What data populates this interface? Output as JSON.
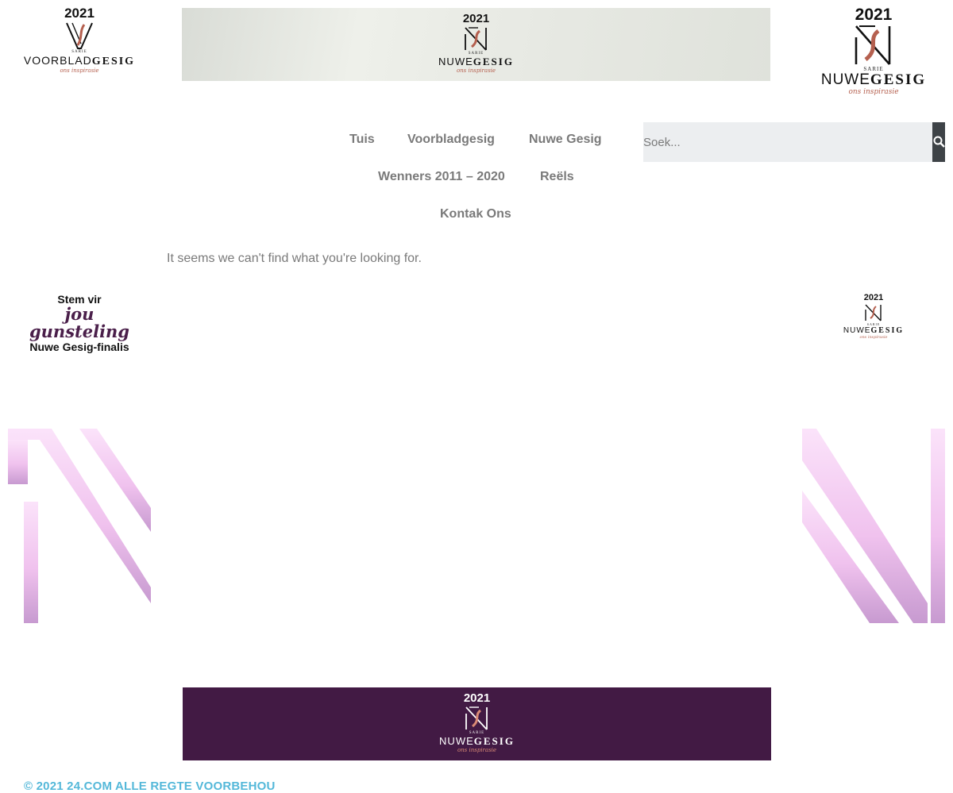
{
  "header": {
    "logo_left": {
      "year": "2021",
      "brand_small": "SARIE",
      "word_light": "VOORBLAD",
      "word_bold": "GESIG",
      "tagline": "ons inspirasie",
      "icon": "vn-monogram-icon"
    },
    "banner_top": {
      "year": "2021",
      "brand_small": "SARIE",
      "word_light": "NUWE",
      "word_bold": "GESIG",
      "tagline": "ons inspirasie",
      "icon": "ng-monogram-icon"
    },
    "logo_right": {
      "year": "2021",
      "brand_small": "SARIE",
      "word_light": "NUWE",
      "word_bold": "GESIG",
      "tagline": "ons inspirasie",
      "icon": "ng-monogram-icon"
    }
  },
  "nav": {
    "items": [
      "Tuis",
      "Voorbladgesig",
      "Nuwe Gesig",
      "Wenners 2011 – 2020",
      "Reëls",
      "Kontak Ons"
    ]
  },
  "search": {
    "placeholder": "Soek...",
    "value": "",
    "icon": "search-icon"
  },
  "main": {
    "message": "It seems we can't find what you're looking for."
  },
  "sidebar_left": {
    "line1": "Stem vir",
    "line2": "jou gunsteling",
    "line3": "Nuwe Gesig-finalis"
  },
  "sidebar_right": {
    "year": "2021",
    "brand_small": "SARIE",
    "word_light": "NUWE",
    "word_bold": "GESIG",
    "tagline": "ons inspirasie",
    "icon": "ng-monogram-icon"
  },
  "decorations": {
    "left": "pink-n-outline-left",
    "right": "pink-n-outline-right"
  },
  "banner_bottom": {
    "year": "2021",
    "brand_small": "SARIE",
    "word_light": "NUWE",
    "word_bold": "GESIG",
    "tagline": "ons inspirasie",
    "icon": "ng-monogram-icon"
  },
  "footer": {
    "copyright": "© 2021 24.COM ALLE REGTE VOORBEHOU"
  },
  "colors": {
    "nav_text": "#7a7a7a",
    "search_button": "#3e4347",
    "search_bg": "#eceef0",
    "banner_purple": "#421a44",
    "footer_link": "#54b8d9",
    "decoration_pink": "#f3c4ef",
    "decoration_purple": "#c79ad0",
    "tagline_copper": "#b5604f"
  }
}
